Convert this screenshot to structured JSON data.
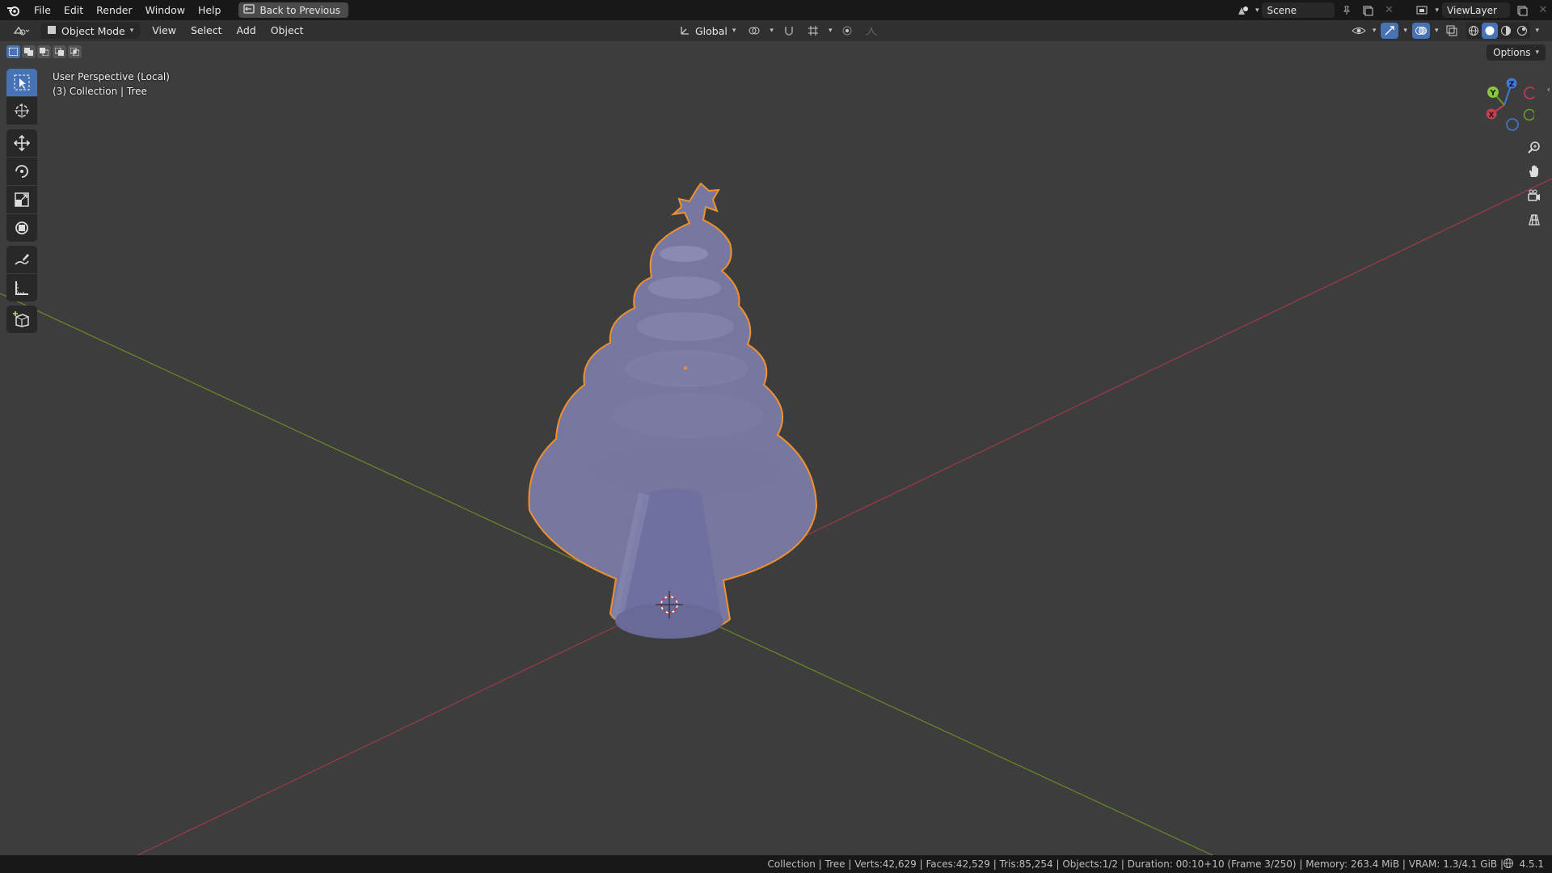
{
  "topbar": {
    "menus": [
      "File",
      "Edit",
      "Render",
      "Window",
      "Help"
    ],
    "back_button": "Back to Previous",
    "scene_name": "Scene",
    "view_layer": "ViewLayer"
  },
  "header": {
    "mode": "Object Mode",
    "menus": [
      "View",
      "Select",
      "Add",
      "Object"
    ],
    "orientation": "Global",
    "options": "Options"
  },
  "viewport": {
    "perspective": "User Perspective (Local)",
    "collection": "(3) Collection | Tree",
    "axis_colors": {
      "x": "#c0404f",
      "y": "#6f9a2a",
      "z": "#3d7ad6"
    },
    "object_color": "#77779f",
    "selection_color": "#f0912f"
  },
  "gizmo": {
    "x": "X",
    "y": "Y",
    "z": "Z"
  },
  "tools": [
    "select-box",
    "cursor",
    "move",
    "rotate",
    "scale",
    "transform",
    "annotate",
    "measure",
    "add-cube"
  ],
  "statusbar": {
    "stats": "Collection | Tree | Verts:42,629 | Faces:42,529 | Tris:85,254 | Objects:1/2 | Duration: 00:10+10 (Frame 3/250) | Memory: 263.4 MiB | VRAM: 1.3/4.1 GiB |",
    "version": "4.5.1"
  }
}
